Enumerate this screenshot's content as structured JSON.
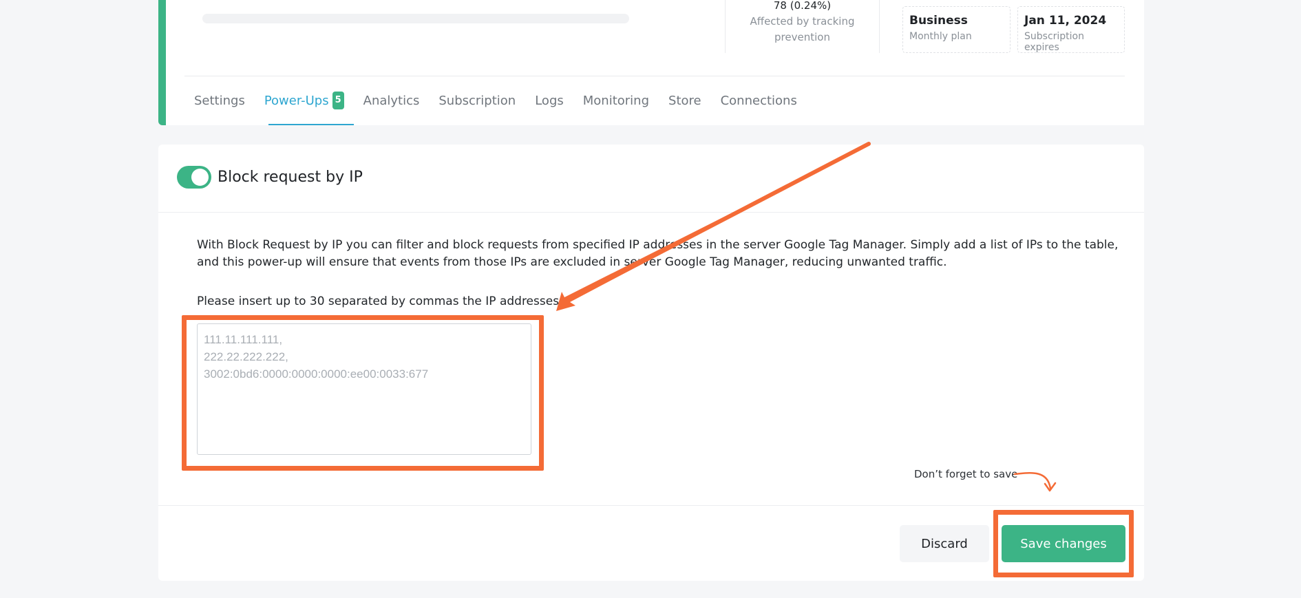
{
  "stats": {
    "tracking_value": "78 (0.24%)",
    "tracking_label": "Affected by tracking prevention"
  },
  "plan": {
    "name": "Business",
    "period": "Monthly plan"
  },
  "subscription": {
    "date": "Jan 11, 2024",
    "label": "Subscription expires"
  },
  "tabs": [
    {
      "label": "Settings"
    },
    {
      "label": "Power-Ups",
      "badge": "5"
    },
    {
      "label": "Analytics"
    },
    {
      "label": "Subscription"
    },
    {
      "label": "Logs"
    },
    {
      "label": "Monitoring"
    },
    {
      "label": "Store"
    },
    {
      "label": "Connections"
    }
  ],
  "powerup": {
    "title": "Block request by IP",
    "enabled": true,
    "description": "With Block Request by IP you can filter and block requests from specified IP addresses in the server Google Tag Manager. Simply add a list of IPs to the table, and this power-up will ensure that events from those IPs are excluded in server Google Tag Manager, reducing unwanted traffic.",
    "ip_label": "Please insert up to 30 separated by commas the IP addresses:",
    "ip_value": "",
    "ip_placeholder": "111.11.111.111,\n222.22.222.222,\n3002:0bd6:0000:0000:0000:ee00:0033:677"
  },
  "annotation": {
    "save_note": "Don’t forget to save"
  },
  "actions": {
    "discard_label": "Discard",
    "save_label": "Save changes"
  },
  "colors": {
    "accent_green": "#3cb486",
    "tab_active": "#2ea6d0",
    "annotation_orange": "#f46b36"
  }
}
